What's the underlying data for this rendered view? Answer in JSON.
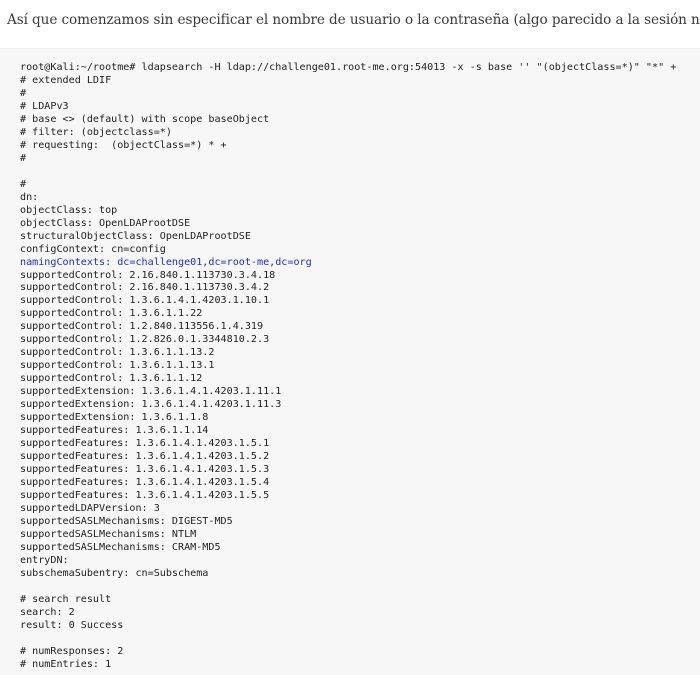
{
  "intro_text": "Así que comenzamos sin especificar el nombre de usuario o la contraseña (algo parecido a la sesión nula)",
  "terminal": {
    "lines": [
      "root@Kali:~/rootme# ldapsearch -H ldap://challenge01.root-me.org:54013 -x -s base '' \"(objectClass=*)\" \"*\" +",
      "# extended LDIF",
      "#",
      "# LDAPv3",
      "# base <> (default) with scope baseObject",
      "# filter: (objectclass=*)",
      "# requesting:  (objectClass=*) * +",
      "#",
      "",
      "#",
      "dn:",
      "objectClass: top",
      "objectClass: OpenLDAProotDSE",
      "structuralObjectClass: OpenLDAProotDSE",
      "configContext: cn=config",
      "namingContexts: dc=challenge01,dc=root-me,dc=org",
      "supportedControl: 2.16.840.1.113730.3.4.18",
      "supportedControl: 2.16.840.1.113730.3.4.2",
      "supportedControl: 1.3.6.1.4.1.4203.1.10.1",
      "supportedControl: 1.3.6.1.1.22",
      "supportedControl: 1.2.840.113556.1.4.319",
      "supportedControl: 1.2.826.0.1.3344810.2.3",
      "supportedControl: 1.3.6.1.1.13.2",
      "supportedControl: 1.3.6.1.1.13.1",
      "supportedControl: 1.3.6.1.1.12",
      "supportedExtension: 1.3.6.1.4.1.4203.1.11.1",
      "supportedExtension: 1.3.6.1.4.1.4203.1.11.3",
      "supportedExtension: 1.3.6.1.1.8",
      "supportedFeatures: 1.3.6.1.1.14",
      "supportedFeatures: 1.3.6.1.4.1.4203.1.5.1",
      "supportedFeatures: 1.3.6.1.4.1.4203.1.5.2",
      "supportedFeatures: 1.3.6.1.4.1.4203.1.5.3",
      "supportedFeatures: 1.3.6.1.4.1.4203.1.5.4",
      "supportedFeatures: 1.3.6.1.4.1.4203.1.5.5",
      "supportedLDAPVersion: 3",
      "supportedSASLMechanisms: DIGEST-MD5",
      "supportedSASLMechanisms: NTLM",
      "supportedSASLMechanisms: CRAM-MD5",
      "entryDN:",
      "subschemaSubentry: cn=Subschema",
      "",
      "# search result",
      "search: 2",
      "result: 0 Success",
      "",
      "# numResponses: 2",
      "# numEntries: 1"
    ],
    "highlighted_line": "namingContexts: dc=challenge01,dc=root-me,dc=org",
    "highlight_color": "#1d2fc8",
    "background_color": "#f7f7f7",
    "text_color": "#222222"
  }
}
